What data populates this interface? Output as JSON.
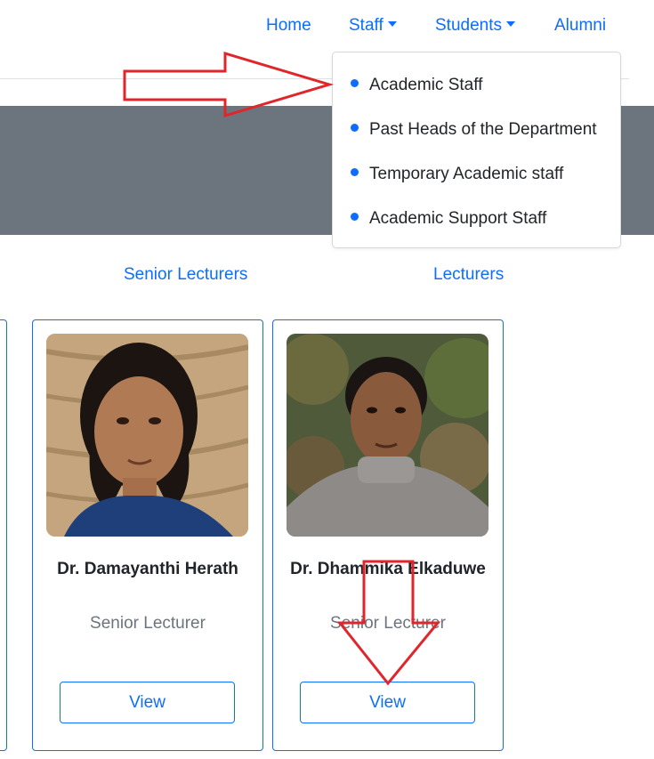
{
  "navbar": {
    "items": [
      {
        "label": "Home"
      },
      {
        "label": "Staff"
      },
      {
        "label": "Students"
      },
      {
        "label": "Alumni"
      }
    ]
  },
  "dropdown": {
    "items": [
      {
        "label": "Academic Staff"
      },
      {
        "label": "Past Heads of the Department"
      },
      {
        "label": "Temporary Academic staff"
      },
      {
        "label": "Academic Support Staff"
      }
    ]
  },
  "category_tabs": [
    {
      "label": "Senior Lecturers"
    },
    {
      "label": "Lecturers"
    }
  ],
  "cards": [
    {
      "name": "Dr. Damayanthi Herath",
      "role": "Senior Lecturer",
      "button": "View"
    },
    {
      "name": "Dr. Dhammika Elkaduwe",
      "role": "Senior Lecturer",
      "button": "View"
    }
  ],
  "colors": {
    "link": "#0d6efd",
    "hero": "#6c757d",
    "annotation_arrow": "#e0262b"
  },
  "icons": {
    "dropdown_caret": "caret-down-icon",
    "annotation": "arrow-annotation"
  }
}
